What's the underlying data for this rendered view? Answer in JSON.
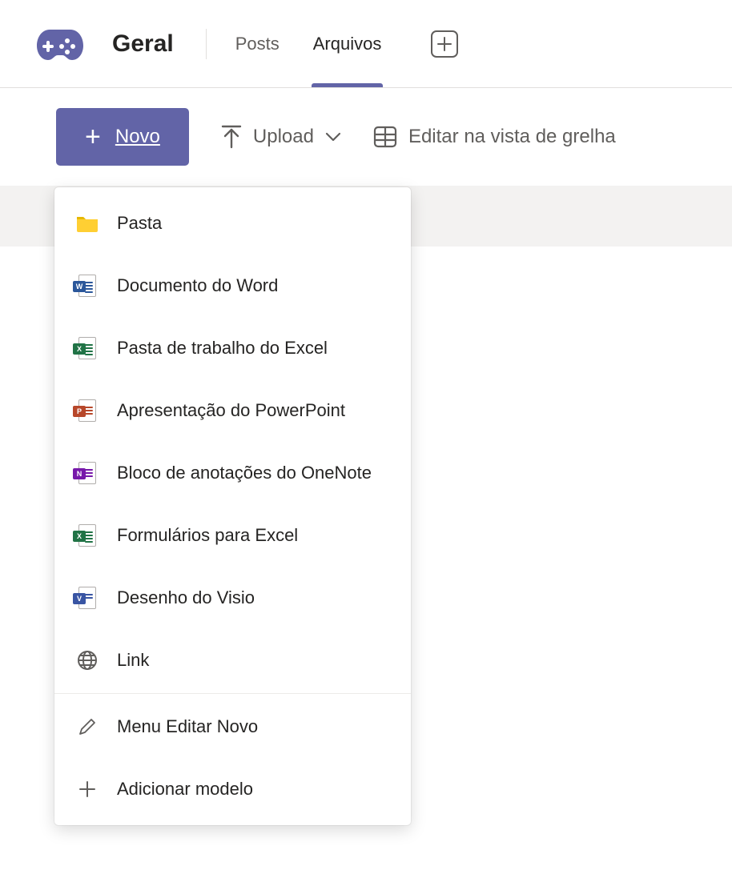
{
  "header": {
    "channel_title": "Geral",
    "tabs": [
      {
        "label": "Posts",
        "active": false
      },
      {
        "label": "Arquivos",
        "active": true
      }
    ]
  },
  "toolbar": {
    "new_label": "Novo",
    "upload_label": "Upload",
    "grid_edit_label": "Editar na vista de grelha"
  },
  "new_menu": {
    "items": [
      {
        "icon": "folder-icon",
        "label": "Pasta"
      },
      {
        "icon": "word-icon",
        "label": "Documento do Word"
      },
      {
        "icon": "excel-icon",
        "label": "Pasta de trabalho do Excel"
      },
      {
        "icon": "powerpoint-icon",
        "label": "Apresentação do PowerPoint"
      },
      {
        "icon": "onenote-icon",
        "label": "Bloco de anotações do OneNote"
      },
      {
        "icon": "excel-forms-icon",
        "label": "Formulários para Excel"
      },
      {
        "icon": "visio-icon",
        "label": "Desenho do Visio"
      },
      {
        "icon": "globe-icon",
        "label": "Link"
      }
    ],
    "footer_items": [
      {
        "icon": "pencil-icon",
        "label": "Menu Editar Novo"
      },
      {
        "icon": "plus-icon",
        "label": "Adicionar modelo"
      }
    ]
  },
  "colors": {
    "primary": "#6264a7",
    "word": "#2b579a",
    "excel": "#217346",
    "powerpoint": "#b7472a",
    "onenote": "#7719aa",
    "visio": "#3955a3",
    "folder": "#ffcf33"
  }
}
